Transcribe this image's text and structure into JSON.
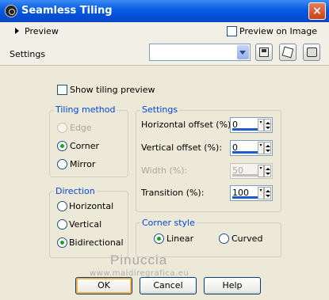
{
  "window": {
    "title": "Seamless Tiling",
    "close_label": "×"
  },
  "top": {
    "preview_toggle": "Preview",
    "preview_on_image": "Preview on Image",
    "settings_label": "Settings",
    "settings_value": ""
  },
  "show_preview": "Show tiling preview",
  "tiling_method": {
    "title": "Tiling method",
    "options": [
      "Edge",
      "Corner",
      "Mirror"
    ],
    "selected": "Corner"
  },
  "direction": {
    "title": "Direction",
    "options": [
      "Horizontal",
      "Vertical",
      "Bidirectional"
    ],
    "selected": "Bidirectional"
  },
  "settings": {
    "title": "Settings",
    "horizontal_offset": {
      "label": "Horizontal offset (%):",
      "value": "0"
    },
    "vertical_offset": {
      "label": "Vertical offset (%):",
      "value": "0"
    },
    "width": {
      "label": "Width (%):",
      "value": "50"
    },
    "transition": {
      "label": "Transition (%):",
      "value": "100"
    }
  },
  "corner_style": {
    "title": "Corner style",
    "options": [
      "Linear",
      "Curved"
    ],
    "selected": "Linear"
  },
  "watermark": {
    "name": "Pinuccia",
    "url": "www.maidiregrafica.eu"
  },
  "buttons": {
    "ok": "OK",
    "cancel": "Cancel",
    "help": "Help"
  },
  "colors": {
    "title_bar": "#0a5fe0",
    "dialog_bg": "#ece9d8",
    "group_title": "#0046d5"
  }
}
